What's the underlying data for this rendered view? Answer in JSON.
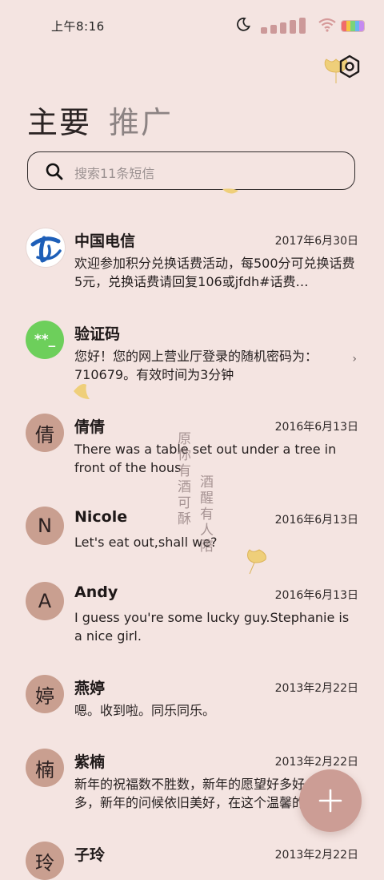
{
  "status_bar": {
    "time": "上午8:16",
    "battery_colors": [
      "#f06b6b",
      "#f4c542",
      "#7ad37a",
      "#6ab4f0",
      "#c58af0"
    ]
  },
  "tabs": {
    "primary": "主要",
    "promo": "推广"
  },
  "search": {
    "placeholder": "搜索11条短信"
  },
  "conversations": [
    {
      "name": "中国电信",
      "date": "2017年6月30日",
      "message": "欢迎参加积分兑换话费活动，每500分可兑换话费5元，兑换话费请回复106或jfdh#话费…",
      "avatar_text": "",
      "avatar_icon": "china-telecom-logo-icon"
    },
    {
      "name": "验证码",
      "date": "",
      "message": "您好！您的网上营业厅登录的随机密码为：710679。有效时间为3分钟",
      "avatar_text": "**_",
      "avatar_color": "#6dcf5b"
    },
    {
      "name": "倩倩",
      "date": "2016年6月13日",
      "message": "There was a table set out under a tree in front of the hous",
      "avatar_text": "倩"
    },
    {
      "name": "Nicole",
      "date": "2016年6月13日",
      "message": "Let's eat out,shall we?",
      "avatar_text": "N"
    },
    {
      "name": "Andy",
      "date": "2016年6月13日",
      "message": "I guess you're some lucky guy.Stephanie is a nice girl.",
      "avatar_text": "A"
    },
    {
      "name": "燕婷",
      "date": "2013年2月22日",
      "message": "嗯。收到啦。同乐同乐。",
      "avatar_text": "婷"
    },
    {
      "name": "紫楠",
      "date": "2013年2月22日",
      "message": "新年的祝福数不胜数，新年的愿望好多好多，新年的问候依旧美好，在这个温馨的",
      "avatar_text": "楠"
    },
    {
      "name": "子玲",
      "date": "2013年2月22日",
      "message": "",
      "avatar_text": "玲"
    }
  ],
  "overlay_text": {
    "line1": "原你有酒可酥",
    "line2": "酒醒有人陪"
  },
  "colors": {
    "background": "#f4e4e1",
    "avatar": "#c99f90",
    "fab": "#cc9d95"
  }
}
